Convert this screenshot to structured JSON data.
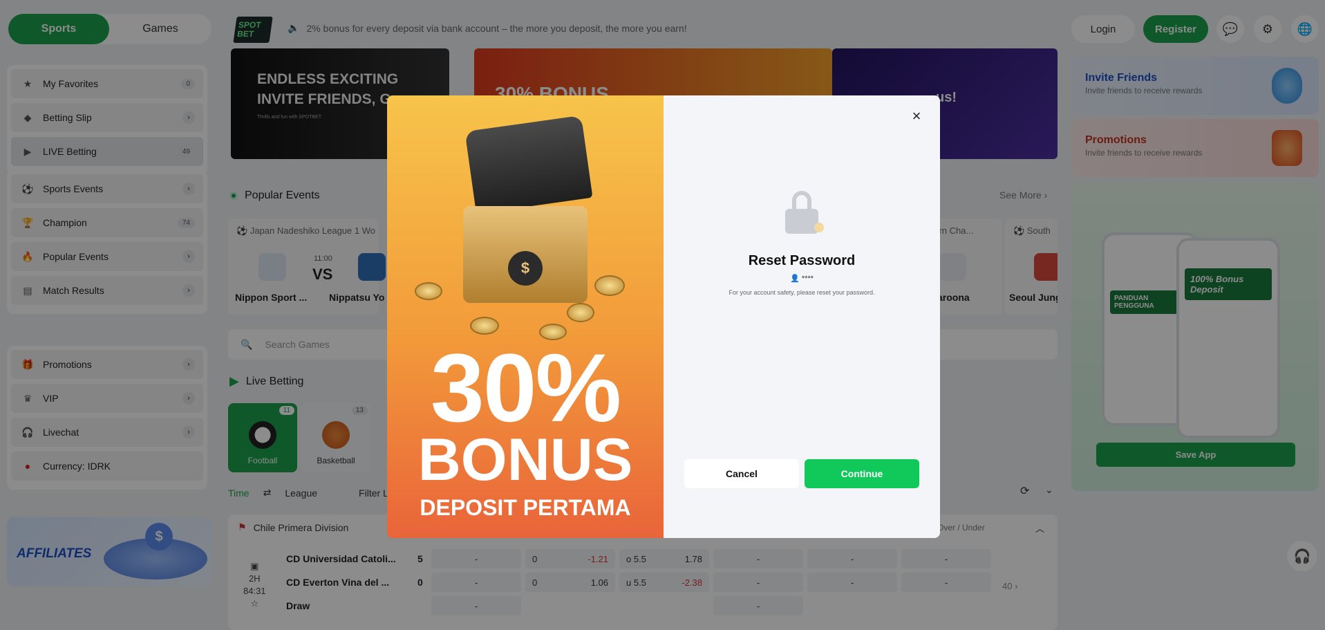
{
  "header": {
    "tabs": [
      {
        "label": "Sports"
      },
      {
        "label": "Games"
      }
    ],
    "logo": {
      "line1": "SPOT",
      "line2": "BET"
    },
    "announcement": "2% bonus for every deposit via bank account – the more you deposit, the more you earn!",
    "login_label": "Login",
    "register_label": "Register",
    "icons": [
      "chat-icon",
      "settings-icon",
      "globe-icon"
    ]
  },
  "sidebar": {
    "group1": [
      {
        "label": "My Favorites",
        "badge": "0",
        "icon": "star-icon"
      },
      {
        "label": "Betting Slip",
        "icon": "ticket-icon"
      },
      {
        "label": "LIVE Betting",
        "badge": "49",
        "icon": "play-icon"
      }
    ],
    "group2": [
      {
        "label": "Sports Events",
        "icon": "events-icon"
      },
      {
        "label": "Champion",
        "badge": "74",
        "icon": "trophy-icon"
      },
      {
        "label": "Popular Events",
        "icon": "fire-icon"
      },
      {
        "label": "Match Results",
        "icon": "results-icon"
      }
    ],
    "group3": [
      {
        "label": "Promotions",
        "icon": "gift-icon"
      },
      {
        "label": "VIP",
        "icon": "crown-icon"
      },
      {
        "label": "Livechat",
        "icon": "headset-icon"
      },
      {
        "label": "Currency: IDRK",
        "icon": "flag-icon"
      }
    ],
    "affiliates_label": "AFFILIATES"
  },
  "banners": {
    "b1_line1": "ENDLESS EXCITING",
    "b1_line2": "INVITE FRIENDS, G",
    "b1_small": "Thrills and fun with SPOTBET",
    "b2": "30% BONUS",
    "b3": "us!"
  },
  "popular": {
    "title": "Popular Events",
    "see_more": "See More",
    "events": [
      {
        "league": "Japan Nadeshiko League 1 Wo",
        "time": "11:00",
        "vs": "VS",
        "home": "Nippon Sport ...",
        "away": "Nippatsu Yo"
      }
    ],
    "partial": [
      {
        "league": "hern Cha...",
        "team": "aroona"
      },
      {
        "league": "South",
        "team": "Seoul Jung"
      }
    ]
  },
  "search": {
    "placeholder": "Search Games"
  },
  "live": {
    "title": "Live Betting",
    "sports": [
      {
        "label": "Football",
        "count": "11"
      },
      {
        "label": "Basketball",
        "count": "13"
      }
    ],
    "filters": [
      "Time",
      "League",
      "Filter League"
    ]
  },
  "match": {
    "league": "Chile Primera Division",
    "over_under": "Over / Under",
    "period": "2H",
    "clock": "84:31",
    "more": "40",
    "rows": [
      {
        "team": "CD Universidad Catoli...",
        "score": "5",
        "o1": "-",
        "h1": "0",
        "h2": "-1.21",
        "ou1": "o 5.5",
        "ou2": "1.78",
        "x1": "-",
        "x2": "-",
        "x3": "-"
      },
      {
        "team": "CD Everton Vina del ...",
        "score": "0",
        "o1": "-",
        "h1": "0",
        "h2": "1.06",
        "ou1": "u 5.5",
        "ou2": "-2.38",
        "x1": "-",
        "x2": "-",
        "x3": "-"
      },
      {
        "team": "Draw",
        "o1": "-",
        "x1": "-"
      }
    ]
  },
  "right": {
    "invite": {
      "title": "Invite Friends",
      "sub": "Invite friends to receive rewards"
    },
    "promotions": {
      "title": "Promotions",
      "sub": "Invite friends to receive rewards"
    },
    "phone_a": "PANDUAN PENGGUNA",
    "phone_b": "100% Bonus Deposit",
    "save_app": "Save App"
  },
  "modal": {
    "promo_percent": "30%",
    "promo_bonus": "BONUS",
    "promo_sub": "DEPOSIT PERTAMA",
    "close": "×",
    "title": "Reset Password",
    "user": "****",
    "note": "For your account safety, please reset your password.",
    "cancel": "Cancel",
    "continue": "Continue"
  },
  "colors": {
    "brand_green": "#1aa04e",
    "continue_green": "#10c95a",
    "link_blue": "#1a4fc4"
  }
}
